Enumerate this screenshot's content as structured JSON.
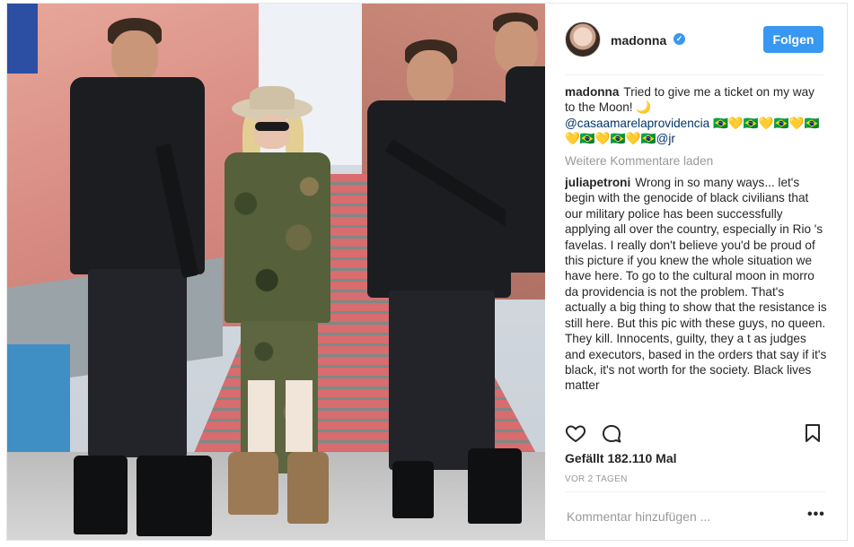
{
  "header": {
    "username": "madonna",
    "follow_label": "Folgen"
  },
  "caption": {
    "author": "madonna",
    "text": "Tried to give me a ticket on my way to the Moon! 🌙",
    "tag": "@casaamarelaprovidencia",
    "emoji_line": "🇧🇷💛🇧🇷💛🇧🇷💛🇧🇷💛🇧🇷💛🇧🇷💛🇧🇷",
    "tag2": "@jr"
  },
  "load_more_label": "Weitere Kommentare laden",
  "comment": {
    "author": "juliapetroni",
    "text": "Wrong in so many ways... let's begin with the genocide of black civilians that our military police has been successfully applying all over the country, especially in Rio 's favelas. I really don't believe you'd be proud of this picture if you knew the whole situation we have here. To go to the cultural moon in morro da providencia is not the problem. That's actually a big thing to show that the resistance is still here. But this pic with these guys, no queen. They kill. Innocents, guilty, they a t as judges and executors, based in the orders that say if it's black, it's not worth for the society. Black lives matter"
  },
  "likes_label": "Gefällt 182.110 Mal",
  "timestamp": "VOR 2 TAGEN",
  "comment_input": {
    "placeholder": "Kommentar hinzufügen ..."
  },
  "icons": {
    "verified": "verified-badge-icon",
    "like": "heart-icon",
    "comment": "speech-bubble-icon",
    "save": "bookmark-icon",
    "more": "more-options-icon"
  },
  "colors": {
    "accent": "#3897f0",
    "link": "#003569",
    "muted": "#999999"
  }
}
